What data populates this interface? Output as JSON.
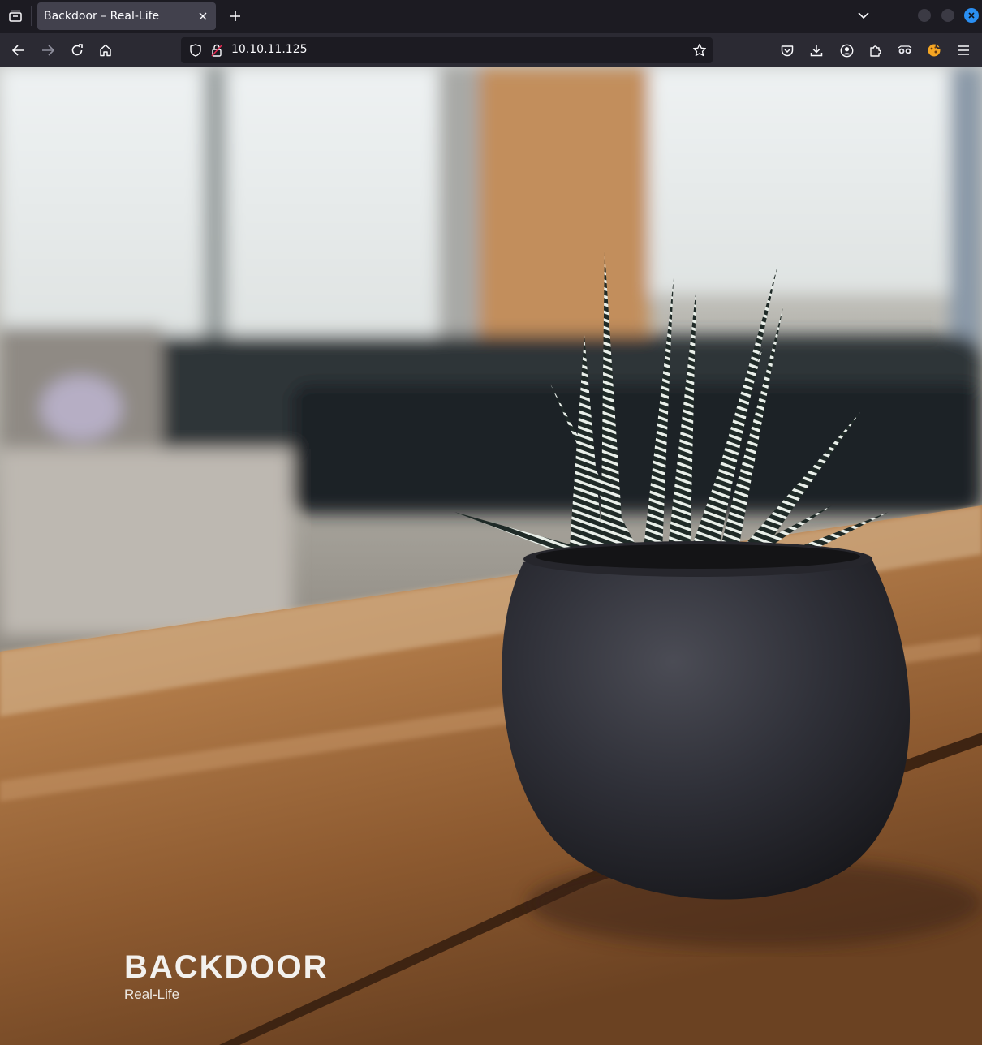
{
  "browser": {
    "tab": {
      "title": "Backdoor – Real-Life"
    },
    "url": "10.10.11.125",
    "icons": {
      "tab_list": "list-all-tabs-icon",
      "close_tab": "close-icon",
      "new_tab": "plus-icon",
      "overflow": "chevron-down-icon",
      "back": "back-arrow-icon",
      "forward": "forward-arrow-icon",
      "reload": "reload-icon",
      "home": "home-icon",
      "tracking": "shield-icon",
      "insecure": "insecure-lock-icon",
      "bookmark": "star-icon",
      "pocket": "pocket-icon",
      "downloads": "download-icon",
      "account": "account-icon",
      "extensions": "puzzle-icon",
      "ext1": "glasses-extension-icon",
      "ext2": "cookie-extension-icon",
      "menu": "hamburger-menu-icon"
    },
    "colors": {
      "accent_close": "#2a8ff2",
      "tab_bg": "#42414d",
      "toolbar_bg": "#2b2a33",
      "frame_bg": "#1c1b22"
    }
  },
  "site": {
    "title": "BACKDOOR",
    "tagline": "Real-Life",
    "hero_image": "potted-succulent-on-wooden-table"
  }
}
